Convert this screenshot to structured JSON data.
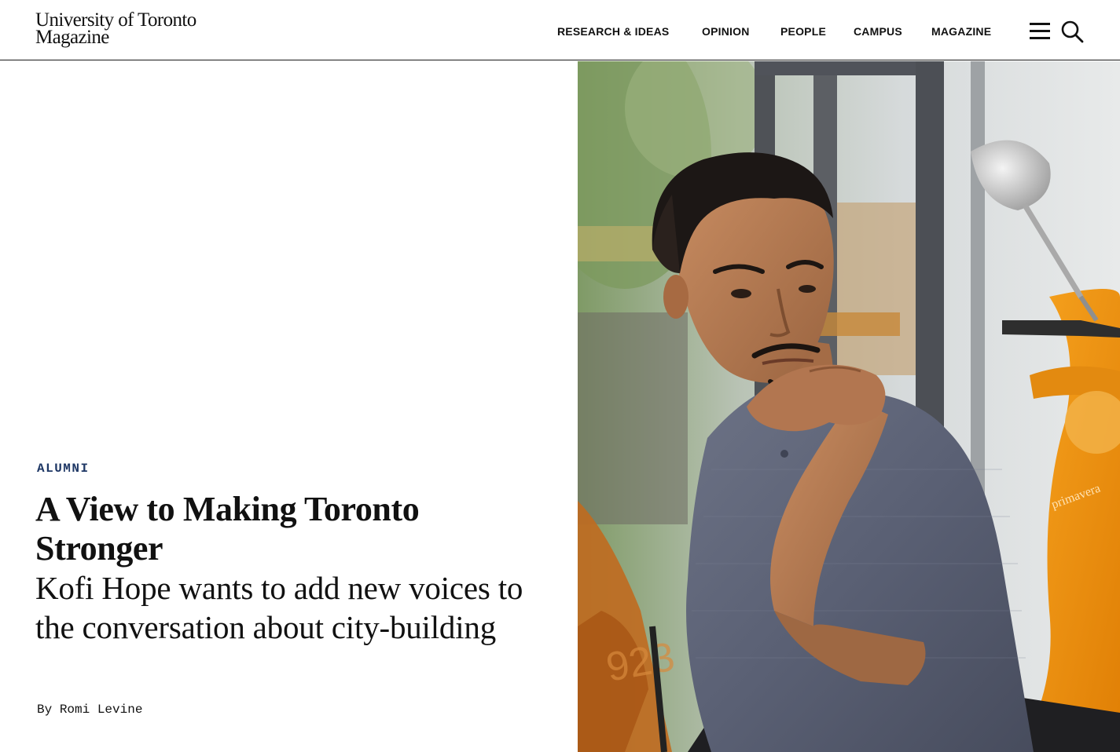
{
  "header": {
    "logo": {
      "line1": "University of Toronto",
      "line2": "Magazine"
    },
    "nav": [
      {
        "label": "RESEARCH & IDEAS"
      },
      {
        "label": "OPINION"
      },
      {
        "label": "PEOPLE"
      },
      {
        "label": "CAMPUS"
      },
      {
        "label": "MAGAZINE"
      }
    ],
    "menu_icon": "hamburger-menu-icon",
    "search_icon": "search-icon"
  },
  "article": {
    "category": "ALUMNI",
    "headline": "A View to Making Toronto Stronger",
    "dek": "Kofi Hope wants to add new voices to the conversation about city-building",
    "byline_prefix": "By",
    "author": "Romi Levine"
  },
  "colors": {
    "category_text": "#1e3765",
    "rule": "#1a1a1a",
    "scooter_orange": "#f0940c"
  }
}
